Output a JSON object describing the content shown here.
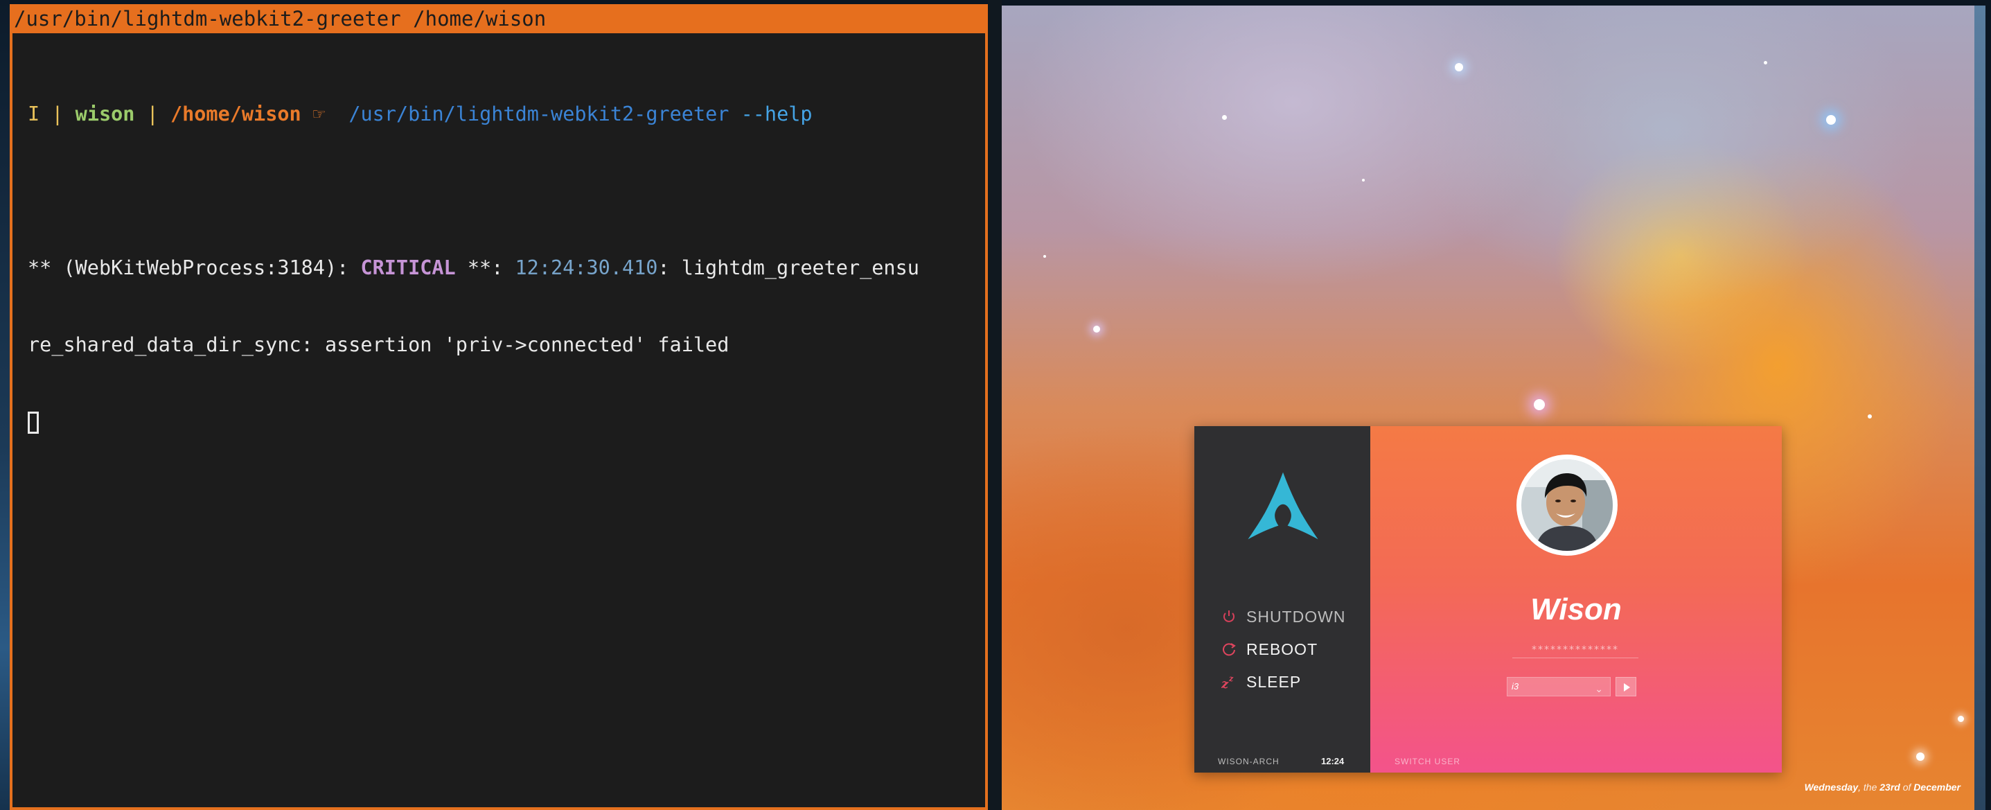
{
  "terminal": {
    "title": "/usr/bin/lightdm-webkit2-greeter /home/wison",
    "prompt": {
      "mode": "I",
      "sep": " | ",
      "user": "wison",
      "cwd": "/home/wison",
      "arrow": "☞",
      "command": "/usr/bin/lightdm-webkit2-greeter",
      "flag": "--help"
    },
    "output": {
      "prefix": "** (WebKitWebProcess:3184): ",
      "level": "CRITICAL",
      "mid": " **: ",
      "timestamp": "12:24:30.410",
      "msg1": ": lightdm_greeter_ensu",
      "msg2": "re_shared_data_dir_sync: assertion 'priv->connected' failed"
    }
  },
  "greeter": {
    "logo_icon": "arch-linux-logo-icon",
    "power": {
      "shutdown": "SHUTDOWN",
      "reboot": "REBOOT",
      "sleep": "SLEEP"
    },
    "hostname": "WISON-ARCH",
    "clock": "12:24",
    "user_name": "Wison",
    "password_placeholder": "**************",
    "session": "i3",
    "switch_user": "SWITCH USER",
    "date": {
      "weekday": "Wednesday",
      "comma": ", ",
      "the": "the",
      "day": "23rd",
      "of": "of",
      "month": "December"
    }
  },
  "colors": {
    "terminal_accent": "#e66f1e",
    "panel_dark": "#2f2f31",
    "arch_blue": "#35b7d6",
    "gradient_top": "#f47a45",
    "gradient_bottom": "#f3538b"
  }
}
